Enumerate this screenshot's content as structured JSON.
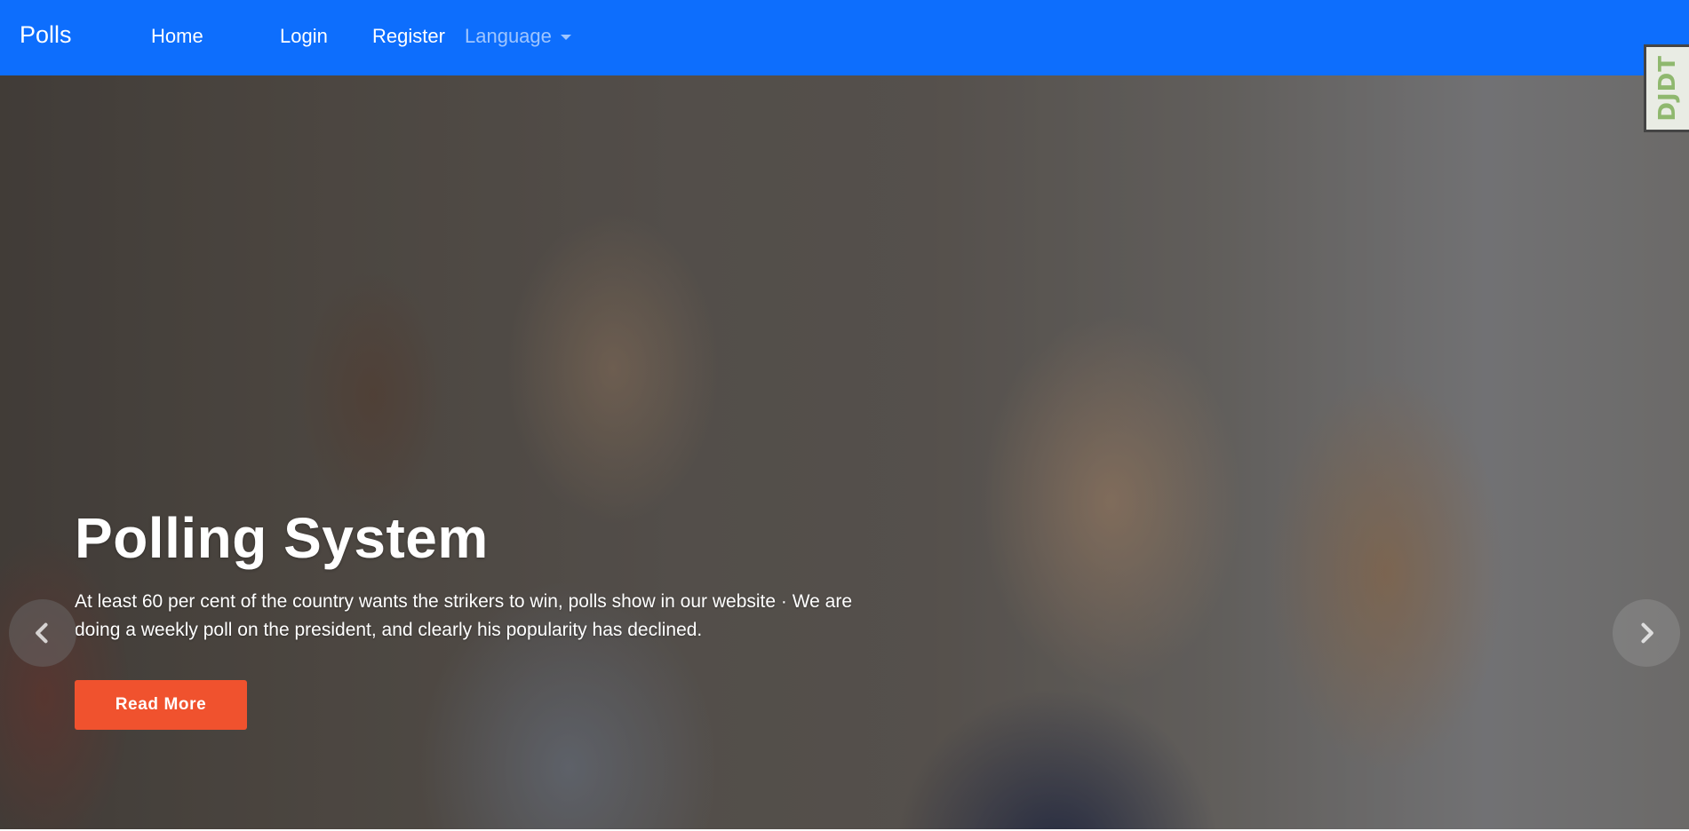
{
  "navbar": {
    "brand": "Polls",
    "links": [
      {
        "label": "Home"
      },
      {
        "label": "Login"
      },
      {
        "label": "Register"
      }
    ],
    "language_dropdown": "Language"
  },
  "debug_toolbar": {
    "label": "DJDT"
  },
  "hero": {
    "title": "Polling System",
    "description": "At least 60 per cent of the country wants the strikers to win, polls show in our website · We are doing a weekly poll on the president, and clearly his popularity has declined.",
    "button_label": "Read More"
  },
  "colors": {
    "navbar": "#0d6efd",
    "button": "#f0522e",
    "text": "#ffffff"
  }
}
